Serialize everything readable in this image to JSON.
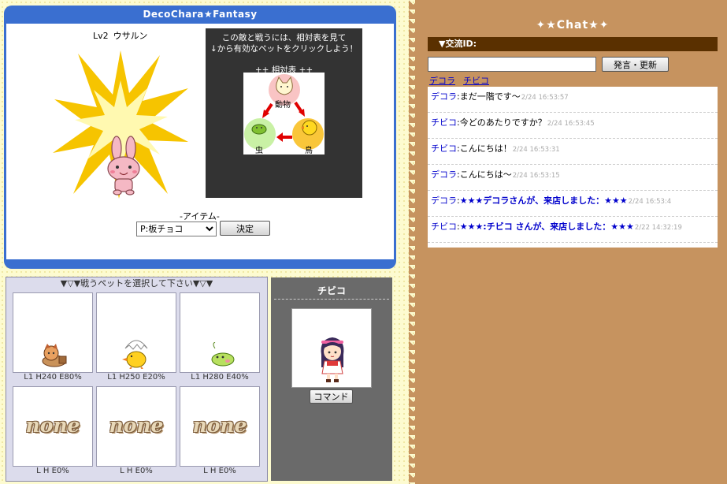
{
  "battle": {
    "title": "DecoChara★Fantasy",
    "enemy_level": "Lv2",
    "enemy_name": "ウサルン",
    "advice_line1": "この敵と戦うには、相対表を見て",
    "advice_line2": "↓から有効なペットをクリックしよう！",
    "chart_title": "++ 相対表 ++",
    "chart_labels": {
      "animal": "動物",
      "insect": "虫",
      "bird": "鳥"
    },
    "item_label": "-アイテム-",
    "item_selected": "P:板チョコ",
    "decide_label": "決定"
  },
  "pets": {
    "title": "▼▽▼戦うペットを選択して下さい▼▽▼",
    "slots": [
      {
        "stats": "L1  H240  E80%",
        "kind": "animal"
      },
      {
        "stats": "L1  H250  E20%",
        "kind": "bird"
      },
      {
        "stats": "L1  H280  E40%",
        "kind": "insect"
      },
      {
        "stats": "L  H  E0%",
        "kind": "none",
        "none_text": "none"
      },
      {
        "stats": "L  H  E0%",
        "kind": "none",
        "none_text": "none"
      },
      {
        "stats": "L  H  E0%",
        "kind": "none",
        "none_text": "none"
      }
    ]
  },
  "player": {
    "name": "チビコ",
    "command_label": "コマンド"
  },
  "chat": {
    "title": "✦★Chat★✦",
    "id_label": "▼交流ID:",
    "input_value": "",
    "send_label": "発言・更新",
    "users": [
      "デコラ",
      "チビコ"
    ],
    "messages": [
      {
        "user": "デコラ",
        "text": "まだ一階です〜",
        "time": "2/24 16:53:57",
        "style": "normal"
      },
      {
        "user": "チビコ",
        "text": "今どのあたりですか？",
        "time": "2/24 16:53:45",
        "style": "normal"
      },
      {
        "user": "チビコ",
        "text": "こんにちは！",
        "time": "2/24 16:53:31",
        "style": "normal"
      },
      {
        "user": "デコラ",
        "text": "こんにちは〜",
        "time": "2/24 16:53:15",
        "style": "normal"
      },
      {
        "user": "デコラ",
        "text": "★★★デコラさんが、来店しました：★★★",
        "time": "2/24 16:53:4",
        "style": "announce"
      },
      {
        "user": "チビコ",
        "text": "★★★:チビコ さんが、来店しました：★★★",
        "time": "2/22 14:32:19",
        "style": "announce"
      }
    ]
  },
  "colors": {
    "blue_frame": "#3a6fd0",
    "chat_bg": "#c6935f",
    "chat_header": "#5a3000",
    "link": "#0000cc"
  }
}
